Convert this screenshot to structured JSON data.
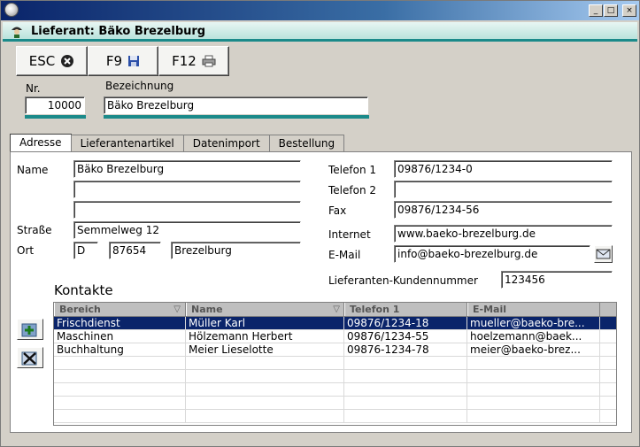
{
  "window": {
    "min_label": "_",
    "max_label": "□",
    "close_label": "×"
  },
  "header": {
    "title": "Lieferant: Bäko Brezelburg"
  },
  "toolbar": {
    "esc_label": "ESC",
    "f9_label": "F9",
    "f12_label": "F12"
  },
  "top": {
    "nr_label": "Nr.",
    "nr_value": "10000",
    "bez_label": "Bezeichnung",
    "bez_value": "Bäko Brezelburg"
  },
  "tabs": [
    "Adresse",
    "Lieferantenartikel",
    "Datenimport",
    "Bestellung"
  ],
  "address": {
    "name_label": "Name",
    "name1": "Bäko Brezelburg",
    "name2": "",
    "name3": "",
    "strasse_label": "Straße",
    "strasse": "Semmelweg 12",
    "ort_label": "Ort",
    "land": "D",
    "plz": "87654",
    "ort": "Brezelburg",
    "telefon1_label": "Telefon 1",
    "telefon1": "09876/1234-0",
    "telefon2_label": "Telefon 2",
    "telefon2": "",
    "fax_label": "Fax",
    "fax": " 09876/1234-56",
    "internet_label": "Internet",
    "internet": "www.baeko-brezelburg.de",
    "email_label": "E-Mail",
    "email": "info@baeko-brezelburg.de",
    "kundennr_label": "Lieferanten-Kundennummer",
    "kundennr": "123456"
  },
  "kontakte": {
    "title": "Kontakte",
    "columns": [
      "Bereich",
      "Name",
      "Telefon 1",
      "E-Mail"
    ],
    "rows": [
      [
        "Frischdienst",
        "Müller Karl",
        "09876/1234-18",
        "mueller@baeko-bre..."
      ],
      [
        "Maschinen",
        "Hölzemann Herbert",
        "09876/1234-55",
        "hoelzemann@baek..."
      ],
      [
        "Buchhaltung",
        "Meier Lieselotte",
        "09876-1234-78",
        "meier@baeko-brez..."
      ]
    ]
  },
  "colors": {
    "accent_teal": "#1b8a8a",
    "selection": "#0a246a",
    "title_blue": "#0a246a"
  }
}
